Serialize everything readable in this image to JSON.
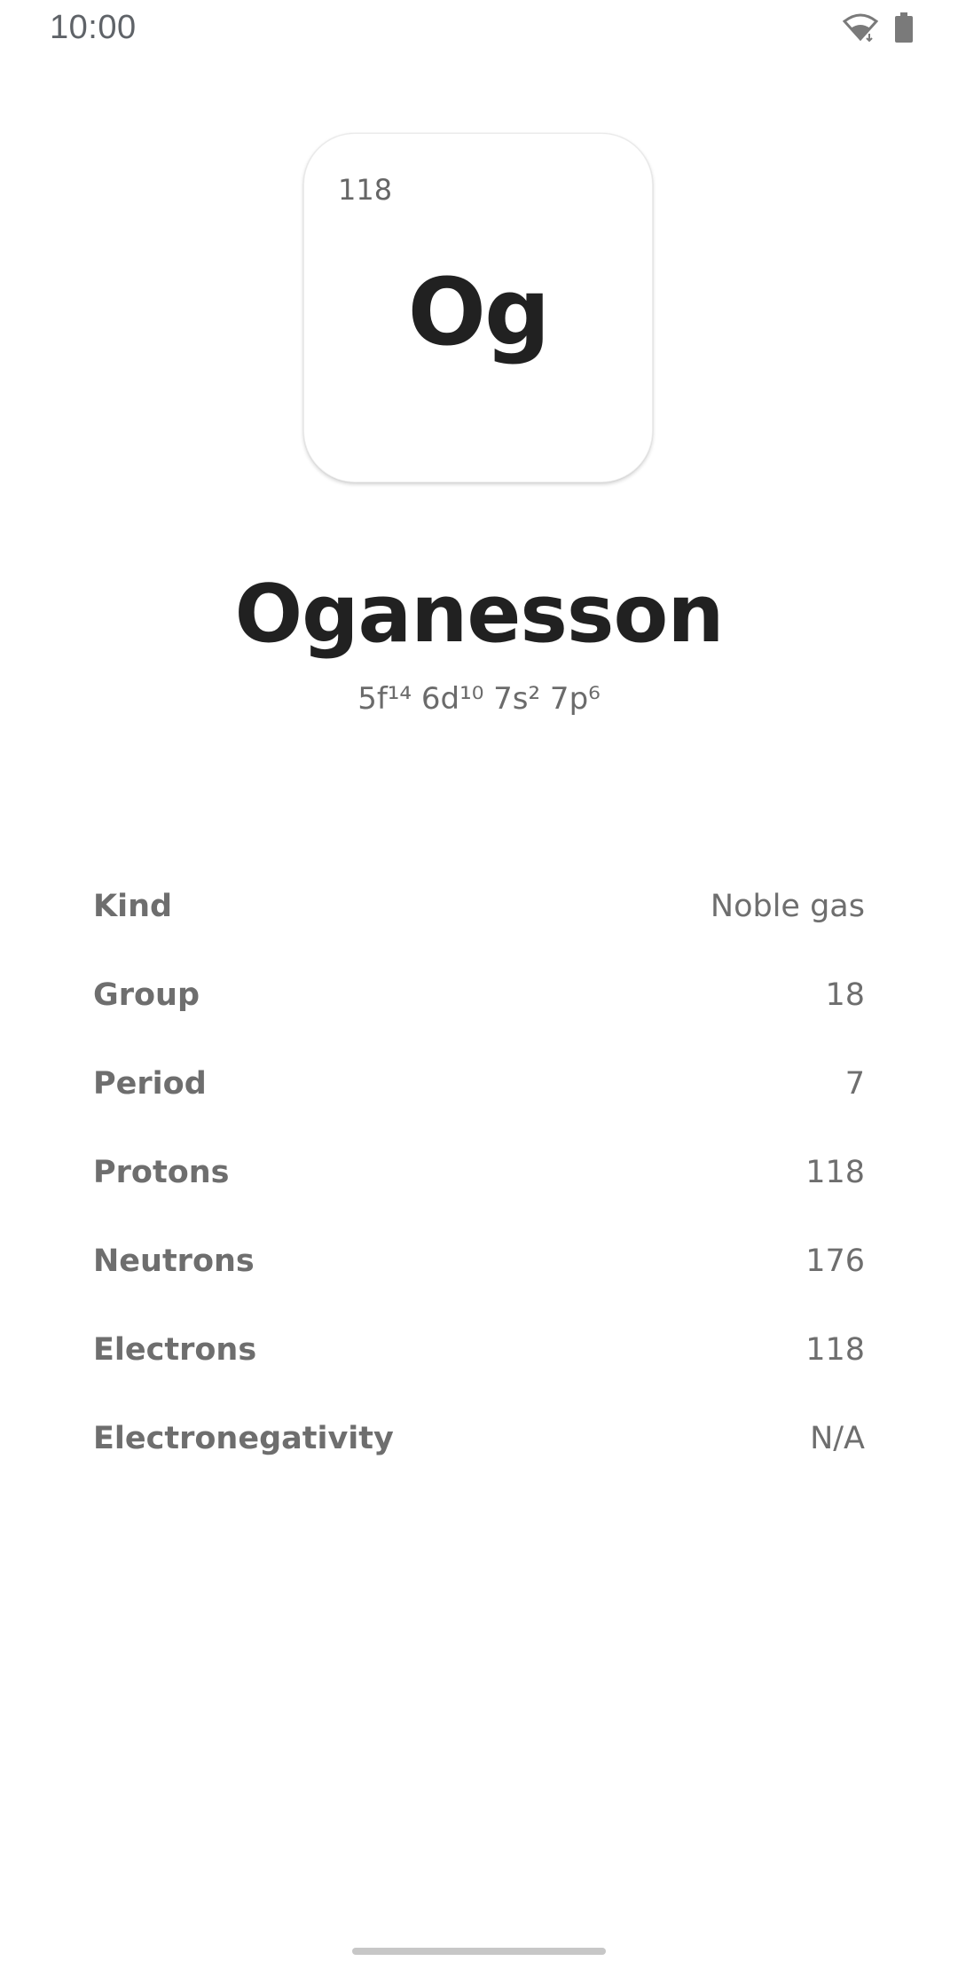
{
  "status_bar": {
    "time": "10:00",
    "icons": [
      "wifi-icon",
      "battery-icon"
    ]
  },
  "element": {
    "atomic_number": "118",
    "symbol": "Og",
    "name": "Oganesson",
    "electron_configuration": "5f¹⁴ 6d¹⁰ 7s² 7p⁶"
  },
  "properties": [
    {
      "label": "Kind",
      "value": "Noble gas"
    },
    {
      "label": "Group",
      "value": "18"
    },
    {
      "label": "Period",
      "value": "7"
    },
    {
      "label": "Protons",
      "value": "118"
    },
    {
      "label": "Neutrons",
      "value": "176"
    },
    {
      "label": "Electrons",
      "value": "118"
    },
    {
      "label": "Electronegativity",
      "value": "N/A"
    }
  ],
  "colors": {
    "background": "#ffffff",
    "primary_text": "#212121",
    "secondary_text": "#6e6e6e"
  }
}
